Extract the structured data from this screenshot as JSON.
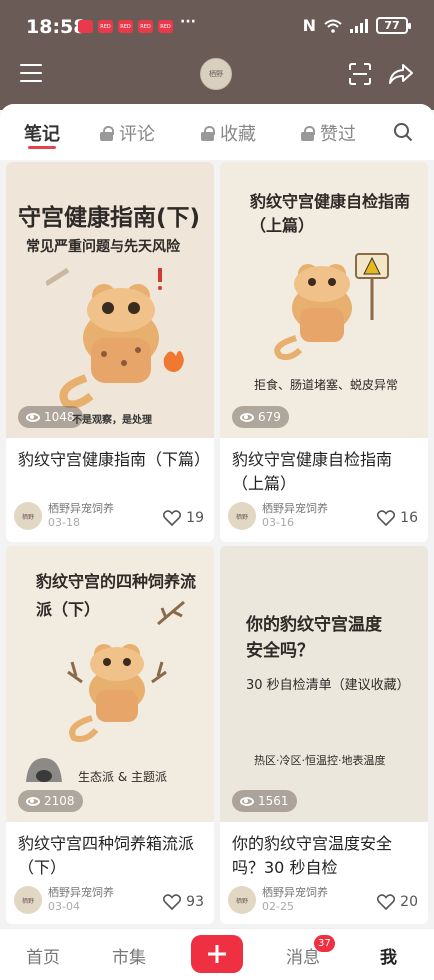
{
  "status_bar": {
    "time": "18:58",
    "notif_labels": [
      "",
      "RED",
      "RED",
      "RED",
      "RED"
    ],
    "more": "···",
    "nfc": "N",
    "battery": "77"
  },
  "header": {
    "avatar_text": "栖野"
  },
  "tabs": [
    {
      "label": "笔记"
    },
    {
      "label": "评论"
    },
    {
      "label": "收藏"
    },
    {
      "label": "赞过"
    }
  ],
  "cards": [
    {
      "cover_title": "守宫健康指南(下)",
      "cover_subtitle": "常见严重问题与先天风险",
      "cover_note": "不是观察，是处理",
      "views": "1048",
      "title": "豹纹守宫健康指南（下篇）",
      "author": "栖野异宠饲养",
      "date": "03-18",
      "likes": "19"
    },
    {
      "cover_title": "豹纹守宫健康自检指南（上篇）",
      "cover_subtitle": "拒食、肠道堵塞、蜕皮异常",
      "views": "679",
      "title": "豹纹守宫健康自检指南（上篇）",
      "author": "栖野异宠饲养",
      "date": "03-16",
      "likes": "16"
    },
    {
      "cover_title": "豹纹守宫的四种饲养流派（下）",
      "cover_subtitle": "生态派 & 主题派",
      "views": "2108",
      "title": "豹纹守宫四种饲养箱流派（下）",
      "author": "栖野异宠饲养",
      "date": "03-04",
      "likes": "93"
    },
    {
      "cover_title": "你的豹纹守宫温度安全吗？",
      "cover_subtitle": "30 秒自检清单（建议收藏）",
      "cover_note": "热区·冷区·恒温控·地表温度",
      "views": "1561",
      "title": "你的豹纹守宫温度安全吗？30 秒自检",
      "author": "栖野异宠饲养",
      "date": "02-25",
      "likes": "20"
    }
  ],
  "bottom_nav": {
    "home": "首页",
    "market": "市集",
    "messages": "消息",
    "messages_badge": "37",
    "me": "我"
  },
  "colors": {
    "header_bg": "#6b5b57",
    "accent": "#ee3042"
  }
}
